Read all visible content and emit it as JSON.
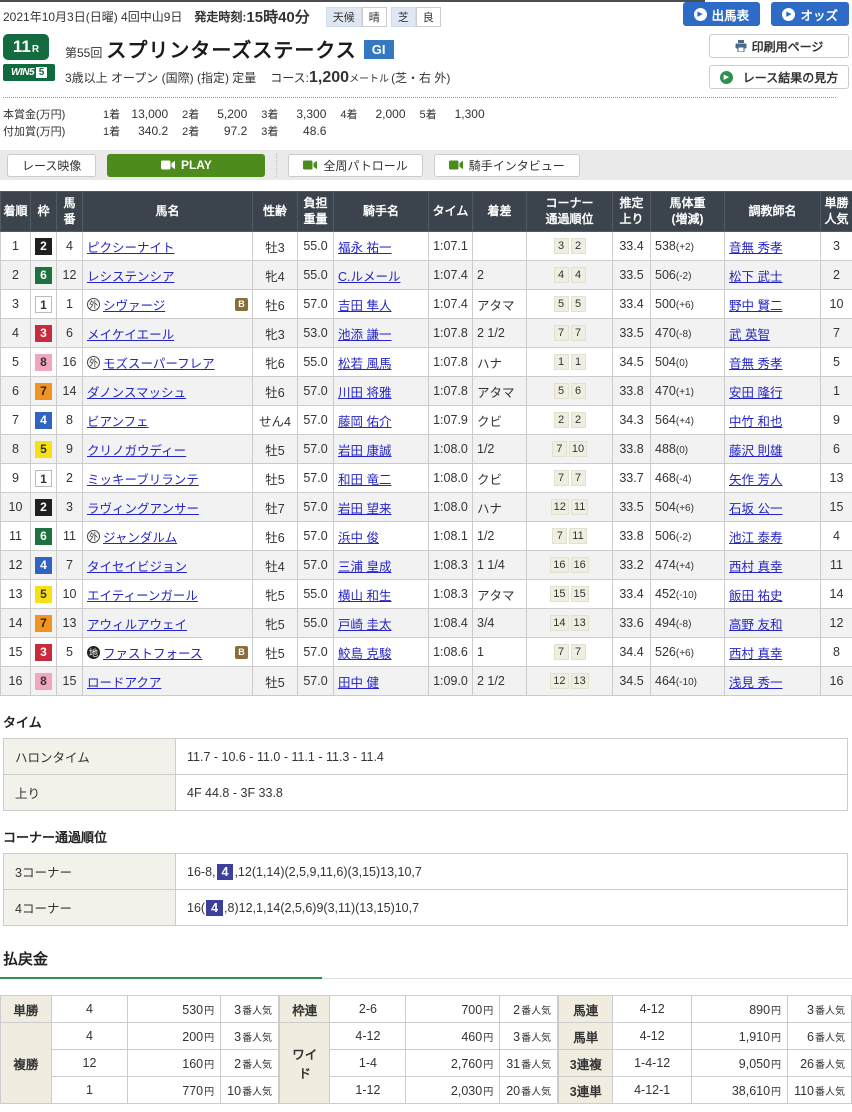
{
  "header": {
    "date_line": "2021年10月3日(日曜) 4回中山9日",
    "start_label": "発走時刻:",
    "start_time": "15時40分",
    "weather": [
      {
        "label": "天候",
        "value": "晴"
      },
      {
        "label": "芝",
        "value": "良"
      }
    ],
    "buttons": [
      "出馬表",
      "オッズ"
    ],
    "side_buttons": [
      "印刷用ページ",
      "レース結果の見方"
    ]
  },
  "race": {
    "number": "11",
    "number_suffix": "R",
    "win5_label": "WIN5",
    "win5_num": "5",
    "ordinal": "第55回",
    "title": "スプリンターズステークス",
    "grade": "GI",
    "conditions": "3歳以上 オープン (国際) (指定) 定量",
    "course_label": "コース:",
    "course_distance": "1,200",
    "course_unit": "メートル",
    "course_detail": "(芝・右 外)"
  },
  "prize": {
    "main_label": "本賞金(万円)",
    "main": [
      [
        "1着",
        "13,000"
      ],
      [
        "2着",
        "5,200"
      ],
      [
        "3着",
        "3,300"
      ],
      [
        "4着",
        "2,000"
      ],
      [
        "5着",
        "1,300"
      ]
    ],
    "extra_label": "付加賞(万円)",
    "extra": [
      [
        "1着",
        "340.2"
      ],
      [
        "2着",
        "97.2"
      ],
      [
        "3着",
        "48.6"
      ]
    ]
  },
  "video_bar": {
    "label": "レース映像",
    "play": "PLAY",
    "patrol": "全周パトロール",
    "interview": "騎手インタビュー"
  },
  "labels": {
    "blinker": "B",
    "foreign_mark": "外",
    "regional_mark": "地"
  },
  "results": {
    "headers": [
      "着順",
      "枠",
      "馬|番",
      "馬名",
      "性齢",
      "負担|重量",
      "騎手名",
      "タイム",
      "着差",
      "コーナー|通過順位",
      "推定|上り",
      "馬体重|(増減)",
      "調教師名",
      "単勝|人気"
    ],
    "rows": [
      {
        "pos": "1",
        "waku": "2",
        "num": "4",
        "mark": "",
        "name": "ピクシーナイト",
        "blinker": false,
        "sex": "牡3",
        "weight": "55.0",
        "jockey": "福永 祐一",
        "time": "1:07.1",
        "margin": "",
        "corners": [
          "3",
          "2"
        ],
        "agari": "33.4",
        "hw": "538",
        "hwd": "(+2)",
        "trainer": "音無 秀孝",
        "ninki": "3"
      },
      {
        "pos": "2",
        "waku": "6",
        "num": "12",
        "mark": "",
        "name": "レシステンシア",
        "blinker": false,
        "sex": "牝4",
        "weight": "55.0",
        "jockey": "C.ルメール",
        "time": "1:07.4",
        "margin": "2",
        "corners": [
          "4",
          "4"
        ],
        "agari": "33.5",
        "hw": "506",
        "hwd": "(-2)",
        "trainer": "松下 武士",
        "ninki": "2"
      },
      {
        "pos": "3",
        "waku": "1",
        "num": "1",
        "mark": "外",
        "name": "シヴァージ",
        "blinker": true,
        "sex": "牡6",
        "weight": "57.0",
        "jockey": "吉田 隼人",
        "time": "1:07.4",
        "margin": "アタマ",
        "corners": [
          "5",
          "5"
        ],
        "agari": "33.4",
        "hw": "500",
        "hwd": "(+6)",
        "trainer": "野中 賢二",
        "ninki": "10"
      },
      {
        "pos": "4",
        "waku": "3",
        "num": "6",
        "mark": "",
        "name": "メイケイエール",
        "blinker": false,
        "sex": "牝3",
        "weight": "53.0",
        "jockey": "池添 謙一",
        "time": "1:07.8",
        "margin": "2 1/2",
        "corners": [
          "7",
          "7"
        ],
        "agari": "33.5",
        "hw": "470",
        "hwd": "(-8)",
        "trainer": "武 英智",
        "ninki": "7"
      },
      {
        "pos": "5",
        "waku": "8",
        "num": "16",
        "mark": "外",
        "name": "モズスーパーフレア",
        "blinker": false,
        "sex": "牝6",
        "weight": "55.0",
        "jockey": "松若 風馬",
        "time": "1:07.8",
        "margin": "ハナ",
        "corners": [
          "1",
          "1"
        ],
        "agari": "34.5",
        "hw": "504",
        "hwd": "(0)",
        "trainer": "音無 秀孝",
        "ninki": "5"
      },
      {
        "pos": "6",
        "waku": "7",
        "num": "14",
        "mark": "",
        "name": "ダノンスマッシュ",
        "blinker": false,
        "sex": "牡6",
        "weight": "57.0",
        "jockey": "川田 将雅",
        "time": "1:07.8",
        "margin": "アタマ",
        "corners": [
          "5",
          "6"
        ],
        "agari": "33.8",
        "hw": "470",
        "hwd": "(+1)",
        "trainer": "安田 隆行",
        "ninki": "1"
      },
      {
        "pos": "7",
        "waku": "4",
        "num": "8",
        "mark": "",
        "name": "ビアンフェ",
        "blinker": false,
        "sex": "せん4",
        "weight": "57.0",
        "jockey": "藤岡 佑介",
        "time": "1:07.9",
        "margin": "クビ",
        "corners": [
          "2",
          "2"
        ],
        "agari": "34.3",
        "hw": "564",
        "hwd": "(+4)",
        "trainer": "中竹 和也",
        "ninki": "9"
      },
      {
        "pos": "8",
        "waku": "5",
        "num": "9",
        "mark": "",
        "name": "クリノガウディー",
        "blinker": false,
        "sex": "牡5",
        "weight": "57.0",
        "jockey": "岩田 康誠",
        "time": "1:08.0",
        "margin": "1/2",
        "corners": [
          "7",
          "10"
        ],
        "agari": "33.8",
        "hw": "488",
        "hwd": "(0)",
        "trainer": "藤沢 則雄",
        "ninki": "6"
      },
      {
        "pos": "9",
        "waku": "1",
        "num": "2",
        "mark": "",
        "name": "ミッキーブリランテ",
        "blinker": false,
        "sex": "牡5",
        "weight": "57.0",
        "jockey": "和田 竜二",
        "time": "1:08.0",
        "margin": "クビ",
        "corners": [
          "7",
          "7"
        ],
        "agari": "33.7",
        "hw": "468",
        "hwd": "(-4)",
        "trainer": "矢作 芳人",
        "ninki": "13"
      },
      {
        "pos": "10",
        "waku": "2",
        "num": "3",
        "mark": "",
        "name": "ラヴィングアンサー",
        "blinker": false,
        "sex": "牡7",
        "weight": "57.0",
        "jockey": "岩田 望来",
        "time": "1:08.0",
        "margin": "ハナ",
        "corners": [
          "12",
          "11"
        ],
        "agari": "33.5",
        "hw": "504",
        "hwd": "(+6)",
        "trainer": "石坂 公一",
        "ninki": "15"
      },
      {
        "pos": "11",
        "waku": "6",
        "num": "11",
        "mark": "外",
        "name": "ジャンダルム",
        "blinker": false,
        "sex": "牡6",
        "weight": "57.0",
        "jockey": "浜中 俊",
        "time": "1:08.1",
        "margin": "1/2",
        "corners": [
          "7",
          "11"
        ],
        "agari": "33.8",
        "hw": "506",
        "hwd": "(-2)",
        "trainer": "池江 泰寿",
        "ninki": "4"
      },
      {
        "pos": "12",
        "waku": "4",
        "num": "7",
        "mark": "",
        "name": "タイセイビジョン",
        "blinker": false,
        "sex": "牡4",
        "weight": "57.0",
        "jockey": "三浦 皇成",
        "time": "1:08.3",
        "margin": "1 1/4",
        "corners": [
          "16",
          "16"
        ],
        "agari": "33.2",
        "hw": "474",
        "hwd": "(+4)",
        "trainer": "西村 真幸",
        "ninki": "11"
      },
      {
        "pos": "13",
        "waku": "5",
        "num": "10",
        "mark": "",
        "name": "エイティーンガール",
        "blinker": false,
        "sex": "牝5",
        "weight": "55.0",
        "jockey": "横山 和生",
        "time": "1:08.3",
        "margin": "アタマ",
        "corners": [
          "15",
          "15"
        ],
        "agari": "33.4",
        "hw": "452",
        "hwd": "(-10)",
        "trainer": "飯田 祐史",
        "ninki": "14"
      },
      {
        "pos": "14",
        "waku": "7",
        "num": "13",
        "mark": "",
        "name": "アウィルアウェイ",
        "blinker": false,
        "sex": "牝5",
        "weight": "55.0",
        "jockey": "戸崎 圭太",
        "time": "1:08.4",
        "margin": "3/4",
        "corners": [
          "14",
          "13"
        ],
        "agari": "33.6",
        "hw": "494",
        "hwd": "(-8)",
        "trainer": "高野 友和",
        "ninki": "12"
      },
      {
        "pos": "15",
        "waku": "3",
        "num": "5",
        "mark": "地",
        "name": "ファストフォース",
        "blinker": true,
        "sex": "牡5",
        "weight": "57.0",
        "jockey": "鮫島 克駿",
        "time": "1:08.6",
        "margin": "1",
        "corners": [
          "7",
          "7"
        ],
        "agari": "34.4",
        "hw": "526",
        "hwd": "(+6)",
        "trainer": "西村 真幸",
        "ninki": "8"
      },
      {
        "pos": "16",
        "waku": "8",
        "num": "15",
        "mark": "",
        "name": "ロードアクア",
        "blinker": false,
        "sex": "牡5",
        "weight": "57.0",
        "jockey": "田中 健",
        "time": "1:09.0",
        "margin": "2 1/2",
        "corners": [
          "12",
          "13"
        ],
        "agari": "34.5",
        "hw": "464",
        "hwd": "(-10)",
        "trainer": "浅見 秀一",
        "ninki": "16"
      }
    ]
  },
  "time_section": {
    "title": "タイム",
    "rows": [
      [
        "ハロンタイム",
        "11.7 - 10.6 - 11.0 - 11.1 - 11.3 - 11.4"
      ],
      [
        "上り",
        "4F 44.8 - 3F 33.8"
      ]
    ]
  },
  "corner_section": {
    "title": "コーナー通過順位",
    "rows": [
      {
        "label": "3コーナー",
        "pre": "16-8,",
        "hl": "4",
        "post": ",12(1,14)(2,5,9,11,6)(3,15)13,10,7"
      },
      {
        "label": "4コーナー",
        "pre": "16(",
        "hl": "4",
        "post": ",8)12,1,14(2,5,6)9(3,11)(13,15)10,7"
      }
    ]
  },
  "payout": {
    "title": "払戻金",
    "yen_suffix": "円",
    "ninki_suffix": "番人気",
    "groups": [
      [
        {
          "type": "単勝",
          "rows": [
            [
              "4",
              "530",
              "3"
            ]
          ]
        },
        {
          "type": "複勝",
          "rows": [
            [
              "4",
              "200",
              "3"
            ],
            [
              "12",
              "160",
              "2"
            ],
            [
              "1",
              "770",
              "10"
            ]
          ]
        }
      ],
      [
        {
          "type": "枠連",
          "rows": [
            [
              "2-6",
              "700",
              "2"
            ]
          ]
        },
        {
          "type": "ワイド",
          "rows": [
            [
              "4-12",
              "460",
              "3"
            ],
            [
              "1-4",
              "2,760",
              "31"
            ],
            [
              "1-12",
              "2,030",
              "20"
            ]
          ]
        }
      ],
      [
        {
          "type": "馬連",
          "rows": [
            [
              "4-12",
              "890",
              "3"
            ]
          ]
        },
        {
          "type": "馬単",
          "rows": [
            [
              "4-12",
              "1,910",
              "6"
            ]
          ]
        },
        {
          "type": "3連複",
          "rows": [
            [
              "1-4-12",
              "9,050",
              "26"
            ]
          ]
        },
        {
          "type": "3連単",
          "rows": [
            [
              "4-12-1",
              "38,610",
              "110"
            ]
          ]
        }
      ]
    ]
  },
  "colors": {
    "button_blue": "#2e6bc6",
    "grade_badge_blue": "#3379bf",
    "jra_green": "#156b40",
    "play_green": "#4d8b1d",
    "link_blue": "#2424c9",
    "table_header_dark": "#3b444c",
    "corner_highlight_navy": "#3c3f9c",
    "payout_label_beige": "#f0ecdf",
    "payout_underline_green": "#2f9150",
    "waku": {
      "1": {
        "bg": "#ffffff",
        "fg": "#333333",
        "border": "#bbbbbb"
      },
      "2": {
        "bg": "#201f1f",
        "fg": "#ffffff"
      },
      "3": {
        "bg": "#c72b3c",
        "fg": "#ffffff"
      },
      "4": {
        "bg": "#3064c2",
        "fg": "#ffffff"
      },
      "5": {
        "bg": "#f7e114",
        "fg": "#333333"
      },
      "6": {
        "bg": "#1d7340",
        "fg": "#ffffff"
      },
      "7": {
        "bg": "#ef9422",
        "fg": "#332200"
      },
      "8": {
        "bg": "#f2a6bd",
        "fg": "#333333"
      }
    }
  }
}
